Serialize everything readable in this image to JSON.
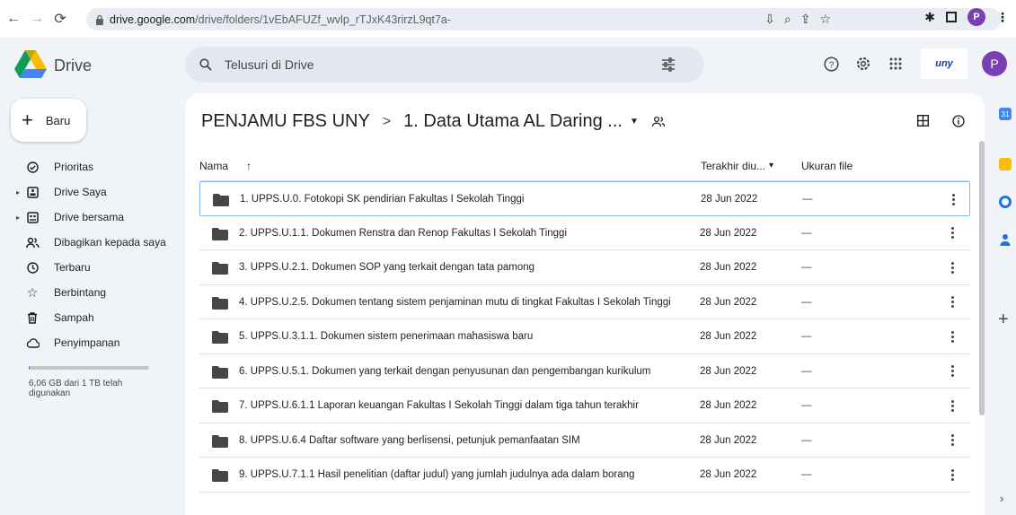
{
  "browser": {
    "url_domain": "drive.google.com",
    "url_path": "/drive/folders/1vEbAFUZf_wvlp_rTJxK43rirzL9qt7a-",
    "profile_letter": "P"
  },
  "header": {
    "app_name": "Drive",
    "search_placeholder": "Telusuri di Drive",
    "avatar_letter": "P",
    "org_logo_text": "uny"
  },
  "sidebar": {
    "new_label": "Baru",
    "items": [
      {
        "label": "Prioritas"
      },
      {
        "label": "Drive Saya"
      },
      {
        "label": "Drive bersama"
      },
      {
        "label": "Dibagikan kepada saya"
      },
      {
        "label": "Terbaru"
      },
      {
        "label": "Berbintang"
      },
      {
        "label": "Sampah"
      },
      {
        "label": "Penyimpanan"
      }
    ],
    "storage_fraction": 0.006,
    "storage_text": "6,06 GB dari 1 TB telah digunakan"
  },
  "main": {
    "breadcrumb_root": "PENJAMU FBS UNY",
    "breadcrumb_sep": ">",
    "breadcrumb_current": "1. Data Utama AL Daring ...",
    "columns": {
      "name": "Nama",
      "name_sort": "↑",
      "modified": "Terakhir diu...",
      "modified_sort": "▾",
      "size": "Ukuran file"
    },
    "rows": [
      {
        "name": "1. UPPS.U.0. Fotokopi SK pendirian Fakultas I Sekolah Tinggi",
        "date": "28 Jun 2022",
        "size": "—"
      },
      {
        "name": "2. UPPS.U.1.1. Dokumen Renstra dan Renop Fakultas I Sekolah Tinggi",
        "date": "28 Jun 2022",
        "size": "—"
      },
      {
        "name": "3. UPPS.U.2.1. Dokumen SOP yang terkait dengan tata pamong",
        "date": "28 Jun 2022",
        "size": "—"
      },
      {
        "name": "4. UPPS.U.2.5. Dokumen tentang sistem penjaminan mutu di tingkat Fakultas I Sekolah Tinggi",
        "date": "28 Jun 2022",
        "size": "—"
      },
      {
        "name": "5. UPPS.U.3.1.1. Dokumen sistem penerimaan mahasiswa baru",
        "date": "28 Jun 2022",
        "size": "—"
      },
      {
        "name": "6. UPPS.U.5.1. Dokumen yang terkait dengan penyusunan dan pengembangan kurikulum",
        "date": "28 Jun 2022",
        "size": "—"
      },
      {
        "name": "7. UPPS.U.6.1.1 Laporan keuangan Fakultas I Sekolah Tinggi dalam tiga tahun terakhir",
        "date": "28 Jun 2022",
        "size": "—"
      },
      {
        "name": "8. UPPS.U.6.4 Daftar software yang berlisensi, petunjuk pemanfaatan SIM",
        "date": "28 Jun 2022",
        "size": "—"
      },
      {
        "name": "9. UPPS.U.7.1.1 Hasil penelitian (daftar judul) yang jumlah judulnya ada dalam borang",
        "date": "28 Jun 2022",
        "size": "—"
      }
    ]
  },
  "colors": {
    "accent": "#0b57d0",
    "profile": "#7b3fb4",
    "background": "#f0f4f9"
  }
}
